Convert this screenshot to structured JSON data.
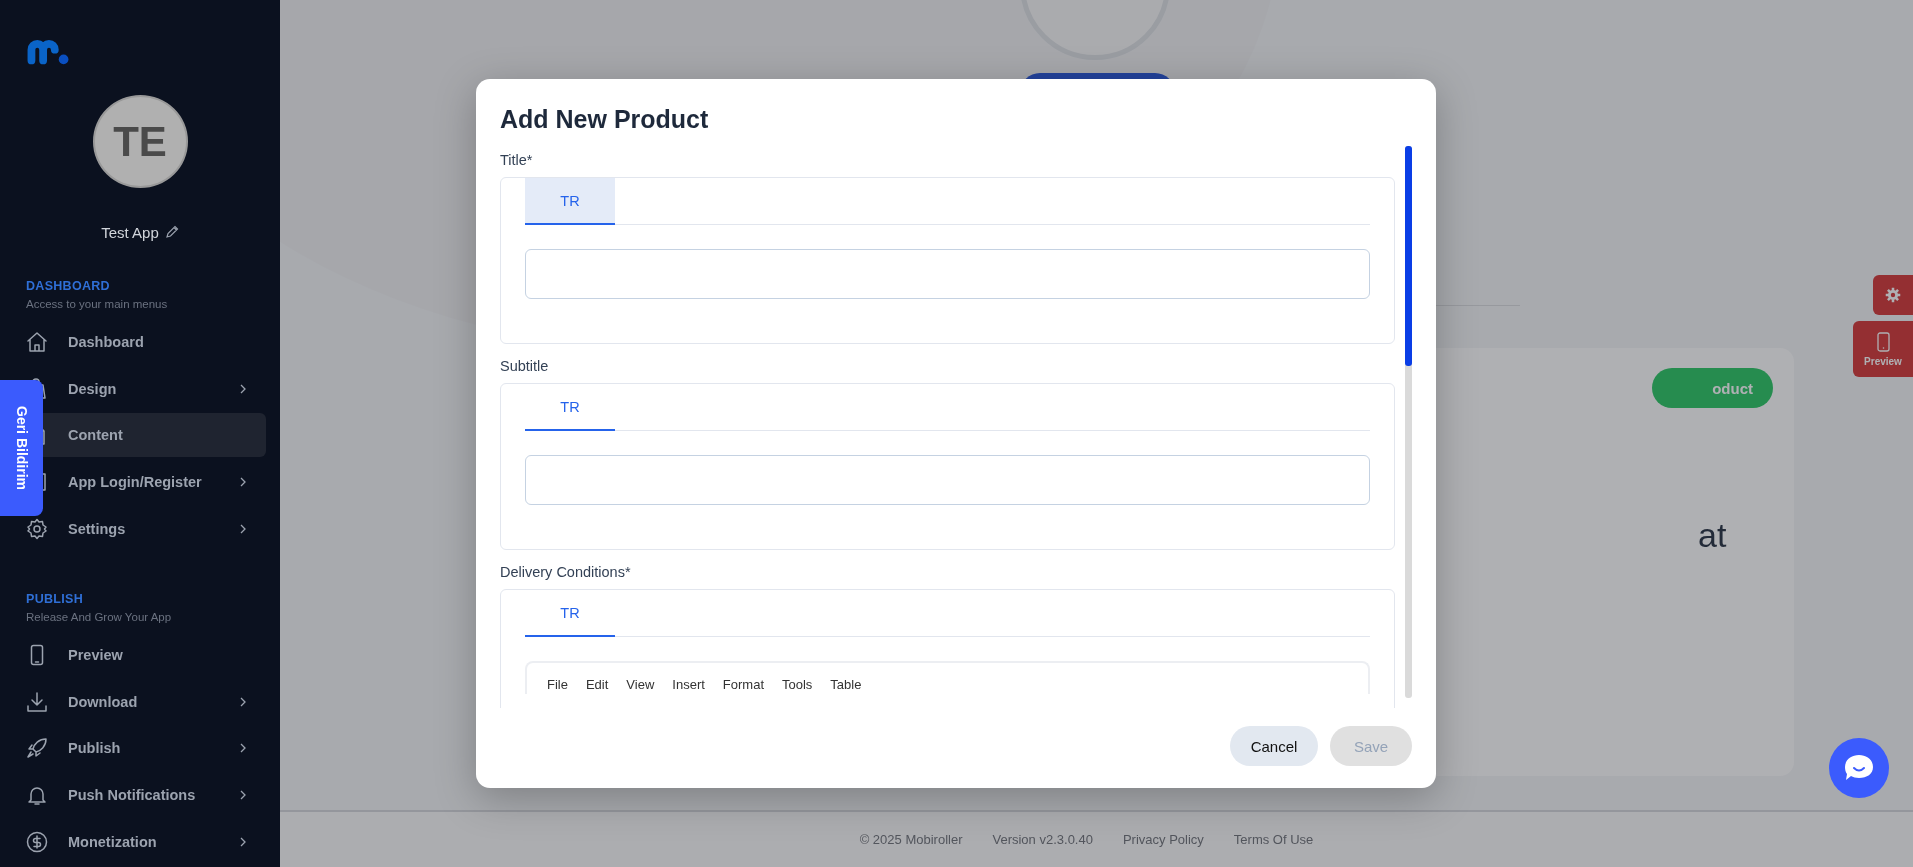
{
  "sidebar": {
    "app_name": "Test App",
    "avatar_initials": "TE",
    "sections": [
      {
        "title": "DASHBOARD",
        "subtitle": "Access to your main menus",
        "items": [
          {
            "label": "Dashboard",
            "kind": "home",
            "has_submenu": false,
            "selected": false
          },
          {
            "label": "Design",
            "kind": "design",
            "has_submenu": true,
            "selected": false
          },
          {
            "label": "Content",
            "kind": "content",
            "has_submenu": false,
            "selected": true
          },
          {
            "label": "App Login/Register",
            "kind": "login",
            "has_submenu": true,
            "selected": false
          },
          {
            "label": "Settings",
            "kind": "gear",
            "has_submenu": true,
            "selected": false
          }
        ]
      },
      {
        "title": "PUBLISH",
        "subtitle": "Release And Grow Your App",
        "items": [
          {
            "label": "Preview",
            "kind": "phone",
            "has_submenu": false,
            "selected": false
          },
          {
            "label": "Download",
            "kind": "download",
            "has_submenu": true,
            "selected": false
          },
          {
            "label": "Publish",
            "kind": "rocket",
            "has_submenu": true,
            "selected": false
          },
          {
            "label": "Push Notifications",
            "kind": "bell",
            "has_submenu": true,
            "selected": false
          },
          {
            "label": "Monetization",
            "kind": "dollar",
            "has_submenu": true,
            "selected": false
          }
        ]
      }
    ]
  },
  "feedback_tab": {
    "label": "Geri Bildirim"
  },
  "background": {
    "button_label": "oduct",
    "heading_fragment": "at"
  },
  "side_buttons": [
    {
      "kind": "settings"
    },
    {
      "kind": "preview",
      "label": "Preview"
    }
  ],
  "modal": {
    "title": "Add New Product",
    "fields": [
      {
        "label": "Title*",
        "kind": "text",
        "tabs": [
          {
            "label": "TR",
            "selected": true,
            "highlighted": true
          }
        ]
      },
      {
        "label": "Subtitle",
        "kind": "text",
        "tabs": [
          {
            "label": "TR",
            "selected": true,
            "highlighted": false
          }
        ]
      },
      {
        "label": "Delivery Conditions*",
        "kind": "rich_text",
        "tabs": [
          {
            "label": "TR",
            "selected": true,
            "highlighted": false
          }
        ],
        "editor_menu": [
          "File",
          "Edit",
          "View",
          "Insert",
          "Format",
          "Tools",
          "Table"
        ]
      }
    ],
    "buttons": [
      {
        "label": "Cancel",
        "kind": "secondary",
        "disabled": false
      },
      {
        "label": "Save",
        "kind": "primary",
        "disabled": true
      }
    ]
  },
  "footer": {
    "items": [
      "© 2025 Mobiroller",
      "Version v2.3.0.40",
      "Privacy Policy",
      "Terms Of Use"
    ]
  }
}
